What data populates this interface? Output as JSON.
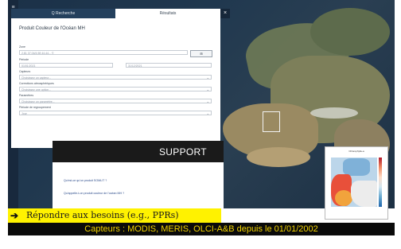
{
  "tabs": [
    {
      "label": "Q Recherche"
    },
    {
      "label": "Résultats"
    }
  ],
  "close_symbol": "×",
  "panel": {
    "title": "Produit Couleur de l'Océan MH",
    "fields": [
      {
        "label": "Zone",
        "value": "2.81 37.04/4.98 44.44... ©"
      },
      {
        "label": "Période",
        "from": "01/01/2021",
        "to": "31/12/2021"
      },
      {
        "label": "Capteurs",
        "value": "Choisissez un capteur..."
      },
      {
        "label": "Corrections atmosphériques",
        "value": "Choisissez une option..."
      },
      {
        "label": "Paramètres",
        "value": "Choisissez un paramètre..."
      },
      {
        "label": "Période de regroupement",
        "value": "Jour"
      }
    ],
    "zone_button": "⊞"
  },
  "support": {
    "title": "SUPPORT",
    "items": [
      "Qu'est-ce qu'un produit SOMLIT ?",
      "Qu'appelle-t-on produit couleur de l'océan MH ?"
    ]
  },
  "inset": {
    "title": "Chlorophylle-a"
  },
  "banner": {
    "arrow": "➔",
    "text": "Répondre aux besoins (e.g., PPRs)"
  },
  "caption": "Capteurs :  MODIS, MERIS, OLCI-A&B  depuis le 01/01/2002"
}
